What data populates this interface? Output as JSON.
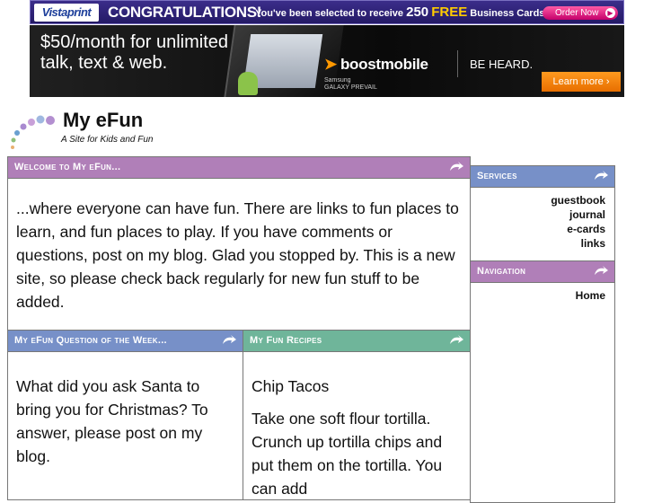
{
  "ads": {
    "vistaprint": {
      "logo": "Vistaprint",
      "congrats": "CONGRATULATIONS!",
      "message_pre": "You've been selected to receive",
      "message_count": "250",
      "message_free": "FREE",
      "message_post": "Business Cards",
      "cta": "Order Now"
    },
    "boost": {
      "tagline": "$50/month for unlimited talk, text & web.",
      "logo": "boostmobile",
      "device_brand": "Samsung",
      "device_model": "GALAXY PREVAIL",
      "slogan": "BE HEARD.",
      "cta": "Learn more"
    }
  },
  "site": {
    "title": "My eFun",
    "tagline": "A Site for Kids and Fun"
  },
  "panels": {
    "welcome": {
      "title": "Welcome to My eFun...",
      "body": "...where everyone can have fun.  There are links to fun places to learn, and fun places to play.  If you have comments or questions, post on my blog.  Glad you stopped by.  This is a new site, so please check back regularly for new fun stuff to be added."
    },
    "question": {
      "title": "My eFun Question of the Week...",
      "body": "What did you ask Santa to bring you for Christmas? To answer, please post on my blog."
    },
    "recipes": {
      "title": "My Fun Recipes",
      "recipe_name": "Chip Tacos",
      "body": "Take one soft flour tortilla. Crunch up tortilla chips and put them on the tortilla.  You can add"
    },
    "services": {
      "title": "Services",
      "links": [
        "guestbook",
        "journal",
        "e-cards",
        "links"
      ]
    },
    "navigation": {
      "title": "Navigation",
      "links": [
        "Home"
      ]
    }
  },
  "colors": {
    "purple_header": "#b07fb8",
    "blue_header": "#7790c8",
    "green_header": "#6fb59a"
  },
  "icons": {
    "panel_corner": "curl-arrow-icon",
    "logo": "dots-arc-logo-icon"
  }
}
